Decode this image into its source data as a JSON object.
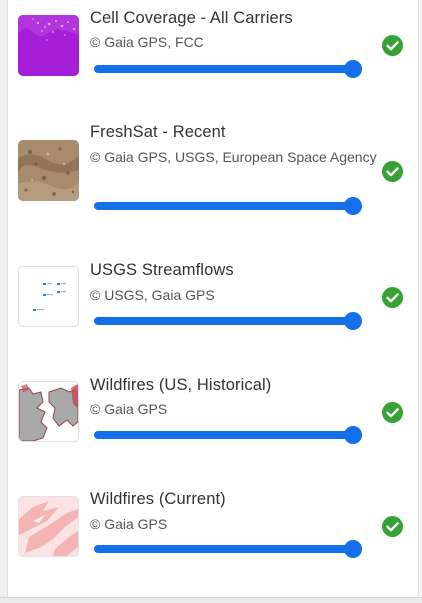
{
  "layers": [
    {
      "title": "Cell Coverage - All Carriers",
      "attribution": "© Gaia GPS, FCC",
      "opacity": 1.0,
      "active": true,
      "thumbnail": "purple-coverage-map-icon"
    },
    {
      "title": "FreshSat - Recent",
      "attribution": "© Gaia GPS, USGS, European Space Agency",
      "opacity": 1.0,
      "active": true,
      "thumbnail": "satellite-terrain-icon"
    },
    {
      "title": "USGS Streamflows",
      "attribution": "© USGS, Gaia GPS",
      "opacity": 1.0,
      "active": true,
      "thumbnail": "streamflow-markers-icon"
    },
    {
      "title": "Wildfires (US, Historical)",
      "attribution": "© Gaia GPS",
      "opacity": 1.0,
      "active": true,
      "thumbnail": "historical-fire-perimeters-icon"
    },
    {
      "title": "Wildfires (Current)",
      "attribution": "© Gaia GPS",
      "opacity": 1.0,
      "active": true,
      "thumbnail": "current-fire-perimeters-icon"
    }
  ],
  "colors": {
    "slider": "#1470ea",
    "check": "#36a236",
    "title": "#333333",
    "attribution": "#555555"
  }
}
